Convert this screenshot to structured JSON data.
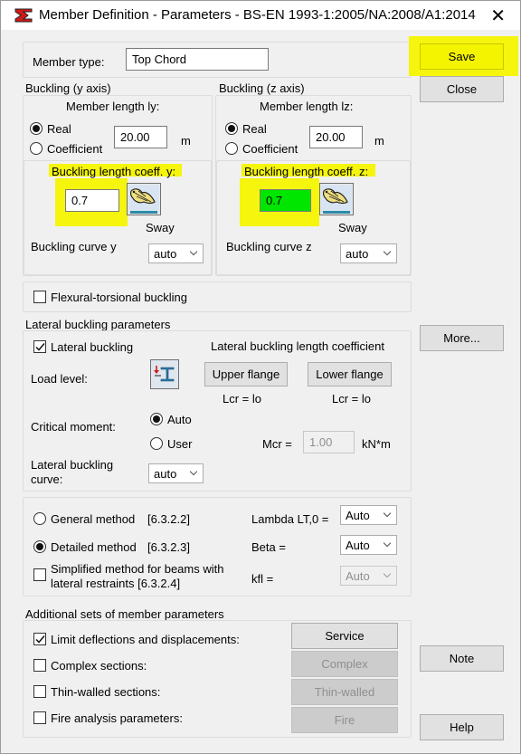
{
  "window": {
    "title": "Member Definition - Parameters - BS-EN 1993-1:2005/NA:2008/A1:2014",
    "close_glyph": "✕"
  },
  "member_type": {
    "label": "Member type:",
    "value": "Top Chord"
  },
  "buckling_y": {
    "group_label": "Buckling (y axis)",
    "length_label": "Member length ly:",
    "real_label": "Real",
    "coefficient_label": "Coefficient",
    "length_value": "20.00",
    "unit": "m",
    "coeff_label": "Buckling length coeff. y:",
    "coeff_value": "0.7",
    "sway_label": "Sway",
    "curve_label": "Buckling curve y",
    "curve_value": "auto"
  },
  "buckling_z": {
    "group_label": "Buckling (z axis)",
    "length_label": "Member length lz:",
    "real_label": "Real",
    "coefficient_label": "Coefficient",
    "length_value": "20.00",
    "unit": "m",
    "coeff_label": "Buckling length coeff. z:",
    "coeff_value": "0.7",
    "sway_label": "Sway",
    "curve_label": "Buckling curve z",
    "curve_value": "auto"
  },
  "flexural_torsional": {
    "label": "Flexural-torsional buckling",
    "checked": false
  },
  "lateral": {
    "group_label": "Lateral buckling parameters",
    "checkbox_label": "Lateral buckling",
    "coeff_title": "Lateral buckling length coefficient",
    "load_level_label": "Load level:",
    "upper_flange": "Upper flange",
    "lower_flange": "Lower flange",
    "lcr_upper": "Lcr =  lo",
    "lcr_lower": "Lcr =  lo",
    "critical_moment_label": "Critical moment:",
    "auto_label": "Auto",
    "user_label": "User",
    "mcr_label": "Mcr =",
    "mcr_value": "1.00",
    "mcr_unit": "kN*m",
    "curve_label_1": "Lateral buckling",
    "curve_label_2": "curve:",
    "curve_value": "auto"
  },
  "methods": {
    "general_label": "General method",
    "general_ref": "[6.3.2.2]",
    "detailed_label": "Detailed method",
    "detailed_ref": "[6.3.2.3]",
    "simplified_label_1": "Simplified method for beams with",
    "simplified_label_2": "lateral restraints [6.3.2.4]",
    "lambda_label": "Lambda LT,0 =",
    "lambda_value": "Auto",
    "beta_label": "Beta =",
    "beta_value": "Auto",
    "kfl_label": "kfl =",
    "kfl_value": "Auto"
  },
  "additional": {
    "group_label": "Additional sets of member parameters",
    "limit_label": "Limit deflections and displacements:",
    "complex_label": "Complex sections:",
    "thin_label": "Thin-walled sections:",
    "fire_label": "Fire analysis parameters:",
    "service_btn": "Service",
    "complex_btn": "Complex",
    "thin_btn": "Thin-walled",
    "fire_btn": "Fire"
  },
  "side_buttons": {
    "save": "Save",
    "close": "Close",
    "more": "More...",
    "note": "Note",
    "help": "Help"
  },
  "colors": {
    "highlight": "#f4f400",
    "green_field": "#00e600"
  }
}
